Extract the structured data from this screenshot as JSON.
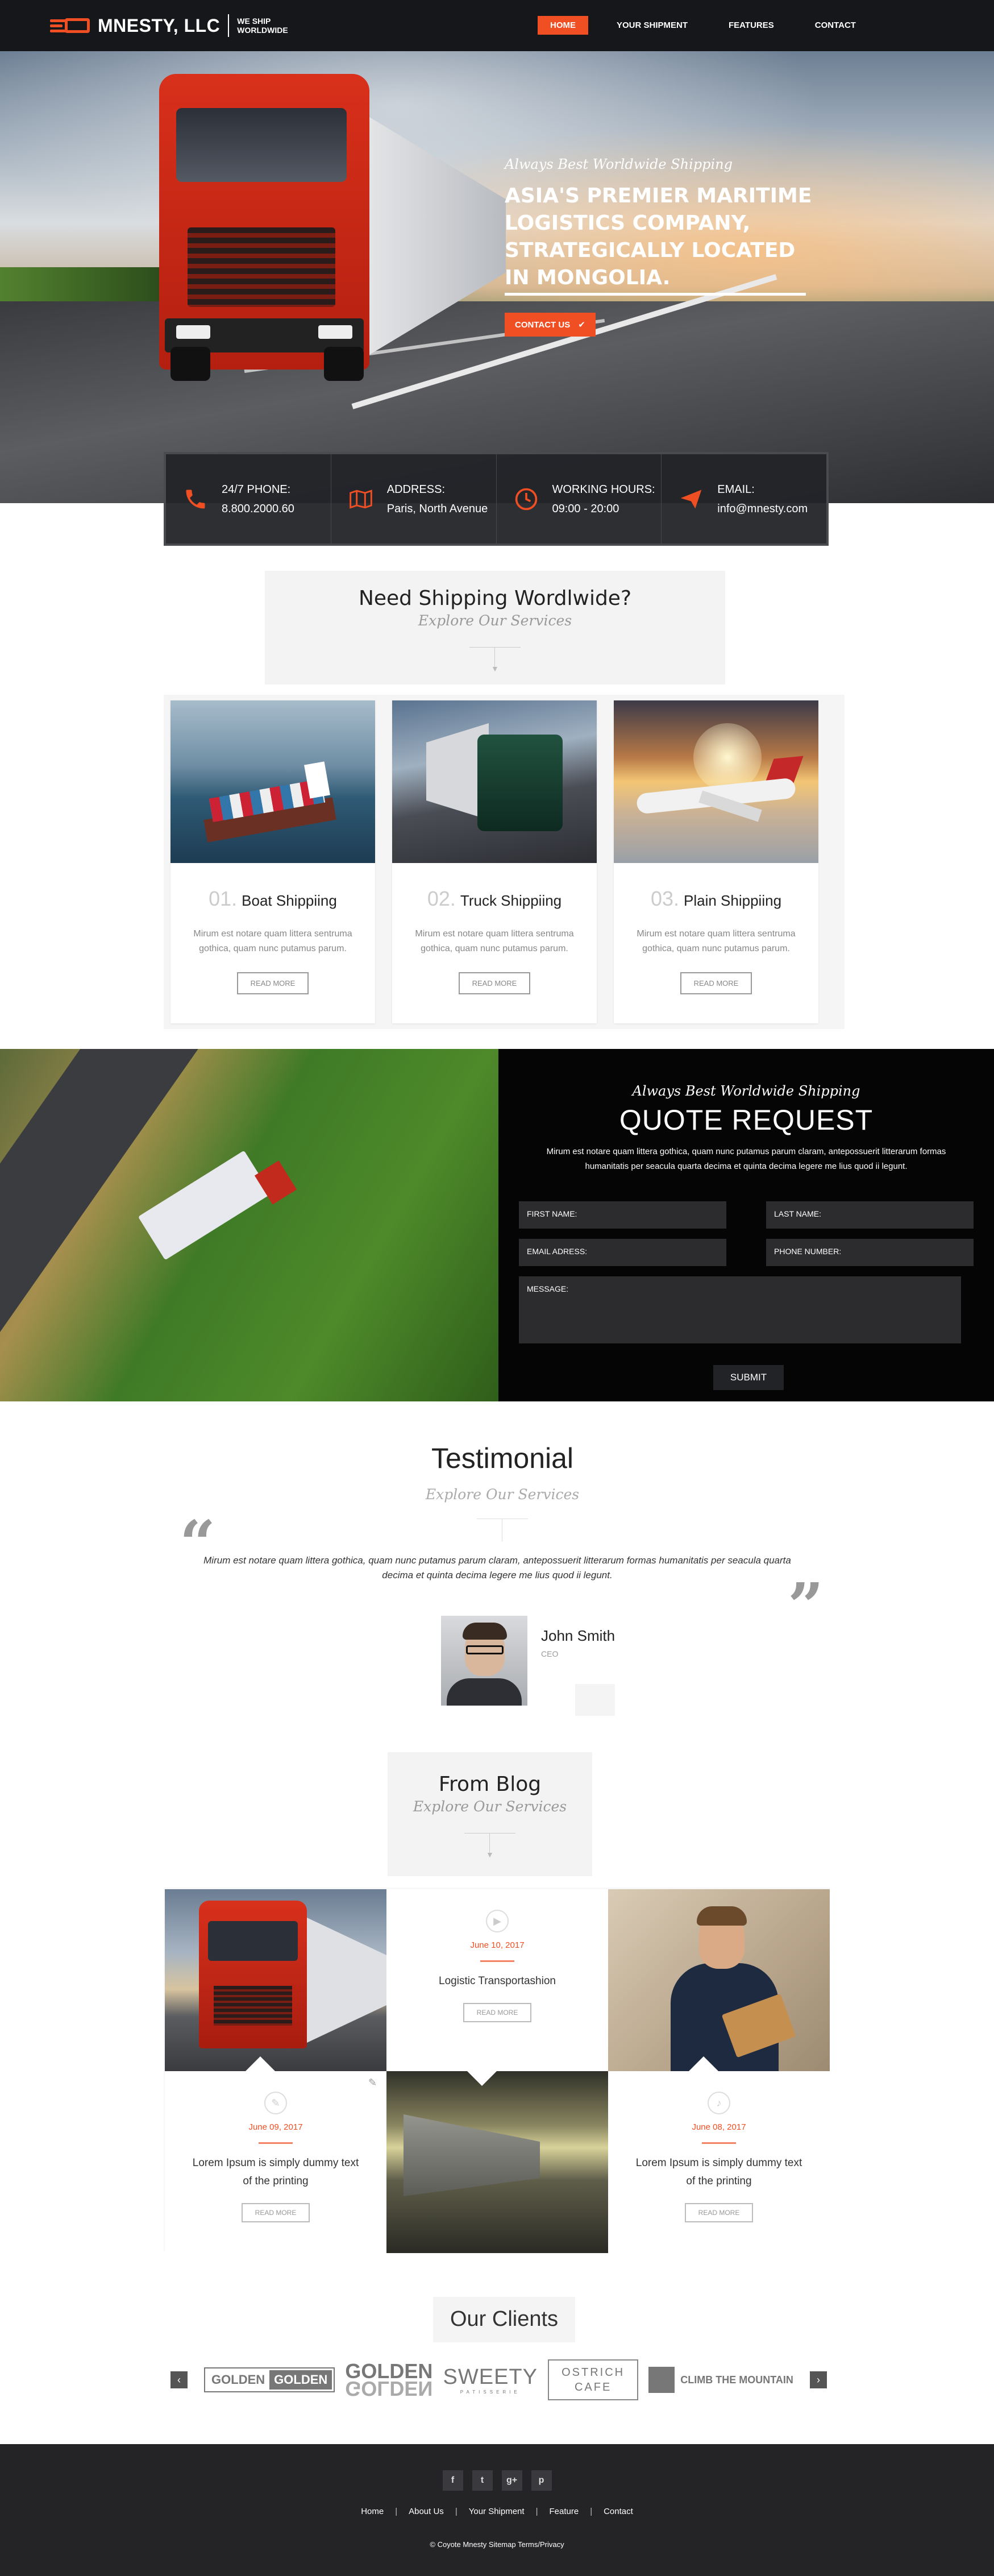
{
  "header": {
    "logo_name": "MNESTY, LLC",
    "logo_tagline": "WE SHIP WORLDWIDE",
    "nav": [
      "HOME",
      "YOUR SHIPMENT",
      "FEATURES",
      "CONTACT"
    ],
    "active_nav": "HOME",
    "accent": "#f04e23"
  },
  "hero": {
    "subtitle": "Always Best Worldwide Shipping",
    "title": "ASIA'S PREMIER MARITIME LOGISTICS COMPANY, STRATEGICALLY LOCATED IN MONGOLIA.",
    "button": "CONTACT US",
    "button_icon": "check-icon"
  },
  "contact_bar": [
    {
      "icon": "phone-icon",
      "label": "24/7 PHONE:",
      "value": "8.800.2000.60"
    },
    {
      "icon": "map-icon",
      "label": "ADDRESS:",
      "value": "Paris, North Avenue"
    },
    {
      "icon": "clock-icon",
      "label": "WORKING HOURS:",
      "value": "09:00 - 20:00"
    },
    {
      "icon": "paper-plane-icon",
      "label": "EMAIL:",
      "value": "info@mnesty.com"
    }
  ],
  "services_section": {
    "title": "Need Shipping Wordlwide?",
    "subtitle": "Explore Our Services"
  },
  "services": [
    {
      "num": "01.",
      "title": "Boat Shippiing",
      "desc": "Mirum est notare quam littera sentruma gothica, quam nunc putamus parum.",
      "button": "READ MORE"
    },
    {
      "num": "02.",
      "title": "Truck Shippiing",
      "desc": "Mirum est notare quam littera sentruma gothica, quam nunc putamus parum.",
      "button": "READ MORE"
    },
    {
      "num": "03.",
      "title": "Plain Shippiing",
      "desc": "Mirum est notare quam littera sentruma gothica, quam nunc putamus parum.",
      "button": "READ MORE"
    }
  ],
  "quote": {
    "subtitle": "Always Best Worldwide Shipping",
    "title": "QUOTE REQUEST",
    "desc": "Mirum est notare quam littera gothica, quam nunc putamus parum claram, antepossuerit litterarum formas humanitatis per seacula quarta decima et quinta decima legere me lius quod ii legunt.",
    "fields": {
      "first_name": "FIRST NAME:",
      "last_name": "LAST NAME:",
      "email": "EMAIL ADRESS:",
      "phone": "PHONE NUMBER:",
      "message": "MESSAGE:"
    },
    "submit": "SUBMIT"
  },
  "testimonial": {
    "title": "Testimonial",
    "subtitle": "Explore Our Services",
    "open_quote": "“",
    "close_quote": "”",
    "text": "Mirum est notare quam littera gothica, quam nunc putamus parum claram, antepossuerit litterarum formas humanitatis per seacula quarta decima et quinta decima legere me lius quod ii legunt.",
    "name": "John Smith",
    "role": "CEO"
  },
  "blog_section": {
    "title": "From Blog",
    "subtitle": "Explore Our Services"
  },
  "blog": [
    {
      "icon": "play-icon",
      "date": "June 10, 2017",
      "title": "Logistic Transportashion",
      "button": "READ MORE"
    },
    {
      "icon": "edit-icon",
      "date": "June 09, 2017",
      "title": "Lorem Ipsum is simply dummy text of the printing",
      "button": "READ MORE"
    },
    {
      "icon": "music-icon",
      "date": "June 08, 2017",
      "title": "Lorem Ipsum is simply dummy text of the printing",
      "button": "READ MORE"
    }
  ],
  "clients": {
    "title": "Our Clients",
    "logos": [
      {
        "a": "GOLDEN",
        "b": "GOLDEN"
      },
      {
        "a": "GOLDEN",
        "b": "GOLDEN"
      },
      {
        "a": "SWEETY",
        "b": "PATISSERIE"
      },
      {
        "a": "OSTRICH",
        "b": "CAFE"
      },
      {
        "a": "CLIMB THE MOUNTAIN"
      }
    ],
    "prev": "‹",
    "next": "›"
  },
  "footer": {
    "socials": [
      "f",
      "t",
      "g+",
      "p"
    ],
    "links": [
      "Home",
      "About Us",
      "Your Shipment",
      "Feature",
      "Contact"
    ],
    "copyright": "© Coyote Mnesty Sitemap Terms/Privacy"
  }
}
